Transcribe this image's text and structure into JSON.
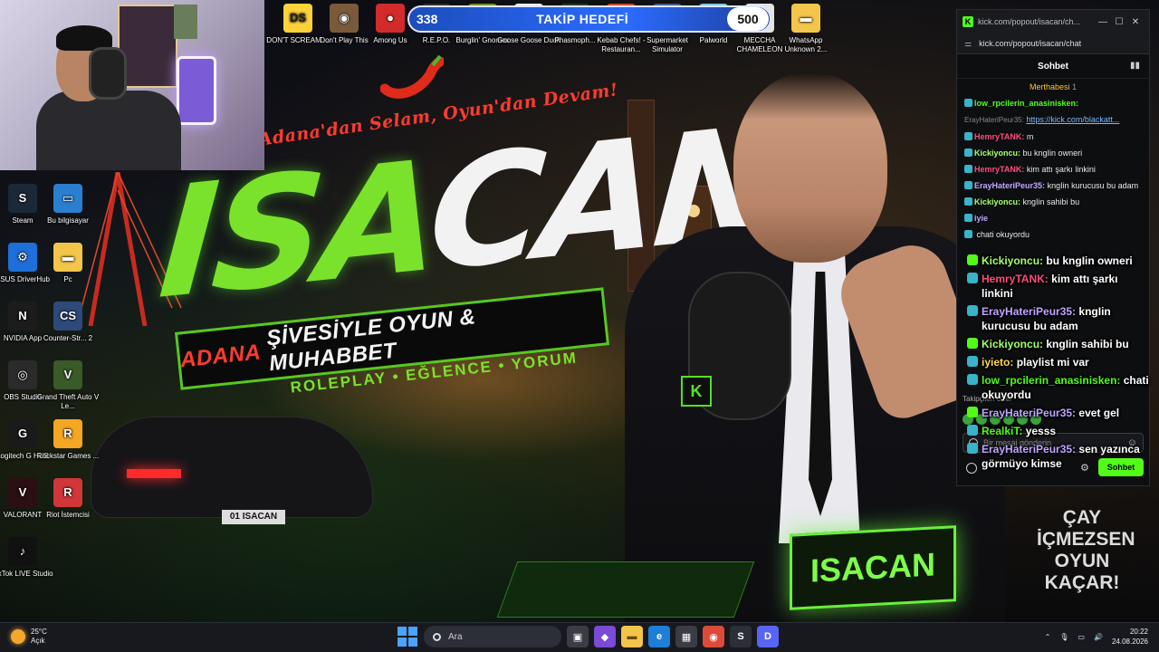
{
  "webcam": {},
  "wallpaper": {
    "tagline": "Adana'dan Selam, Oyun'dan Devam!",
    "logo_part1": "ISA",
    "logo_part2": "CAN",
    "banner_red": "ADANA",
    "banner_white": "ŞİVESİYLE OYUN & MUHABBET",
    "subline": "ROLEPLAY • EĞLENCE • YORUM",
    "desk_sign": "ISACAN",
    "mug_text": [
      "ÇAY",
      "İÇMEZSEN",
      "OYUN",
      "KAÇAR!"
    ],
    "mic_badge": "K",
    "plate": "01 ISACAN"
  },
  "goal": {
    "current": "338",
    "title": "TAKİP HEDEFİ",
    "target": "500",
    "progress": 0.676
  },
  "top_icons": [
    {
      "label": "DON'T SCREAM ...",
      "color": "#ffd23a",
      "glyph": "DS",
      "icon": "dont-scream-icon"
    },
    {
      "label": "Don't Play This",
      "color": "#7a5a3a",
      "glyph": "◉",
      "icon": "dont-play-this-icon"
    },
    {
      "label": "Among Us",
      "color": "#d32b2b",
      "glyph": "●",
      "icon": "among-us-icon"
    },
    {
      "label": "R.E.P.O.",
      "color": "#2d2d2d",
      "glyph": "R",
      "icon": "repo-icon"
    },
    {
      "label": "Burglin' Gnomes",
      "color": "#6b8f2a",
      "glyph": "G",
      "icon": "burglin-gnomes-icon"
    },
    {
      "label": "Goose Goose Duck",
      "color": "#f2f2f2",
      "glyph": "G",
      "icon": "goose-goose-duck-icon"
    },
    {
      "label": "Phasmoph...",
      "color": "#1f3a2e",
      "glyph": "P",
      "icon": "phasmophobia-icon"
    },
    {
      "label": "Kebab Chefs! - Restauran...",
      "color": "#c9462a",
      "glyph": "K",
      "icon": "kebab-chefs-icon"
    },
    {
      "label": "Supermarket Simulator",
      "color": "#3b5e8c",
      "glyph": "S",
      "icon": "supermarket-simulator-icon"
    },
    {
      "label": "Palworld",
      "color": "#7cc6e6",
      "glyph": "P",
      "icon": "palworld-icon"
    },
    {
      "label": "MECCHA CHAMELEON",
      "color": "#e4e4e4",
      "glyph": "M",
      "icon": "meccha-chameleon-icon"
    },
    {
      "label": "WhatsApp Unknown 2...",
      "color": "#f3c54a",
      "glyph": "▬",
      "icon": "folder-icon"
    }
  ],
  "left_icons": [
    {
      "label": "Steam",
      "color": "#1b2838",
      "glyph": "S",
      "icon": "steam-icon"
    },
    {
      "label": "Bu bilgisayar",
      "color": "#2a7fd1",
      "glyph": "▭",
      "icon": "this-pc-icon"
    },
    {
      "label": "ASUS DriverHub",
      "color": "#1e6fd9",
      "glyph": "⚙",
      "icon": "asus-driverhub-icon"
    },
    {
      "label": "Pc",
      "color": "#f3c54a",
      "glyph": "▬",
      "icon": "folder-icon"
    },
    {
      "label": "NVIDIA App",
      "color": "#1c1c1c",
      "glyph": "N",
      "icon": "nvidia-icon"
    },
    {
      "label": "Counter-Str... 2",
      "color": "#2d4a7a",
      "glyph": "CS",
      "icon": "counter-strike-icon"
    },
    {
      "label": "OBS Studio",
      "color": "#2b2b2b",
      "glyph": "◎",
      "icon": "obs-icon"
    },
    {
      "label": "Grand Theft Auto V Le...",
      "color": "#3a5a2a",
      "glyph": "V",
      "icon": "gta-icon"
    },
    {
      "label": "Logitech G HUB",
      "color": "#1a1a1a",
      "glyph": "G",
      "icon": "logitech-ghub-icon"
    },
    {
      "label": "Rockstar Games ...",
      "color": "#f5a623",
      "glyph": "R",
      "icon": "rockstar-icon"
    },
    {
      "label": "VALORANT",
      "color": "#2b0f12",
      "glyph": "V",
      "icon": "valorant-icon"
    },
    {
      "label": "Riot İstemcisi",
      "color": "#d13639",
      "glyph": "R",
      "icon": "riot-client-icon"
    },
    {
      "label": "TikTok LIVE Studio",
      "color": "#111111",
      "glyph": "♪",
      "icon": "tiktok-icon"
    }
  ],
  "chat_window": {
    "title": "kick.com/popout/isacan/ch...",
    "url": "kick.com/popout/isacan/chat",
    "header": "Sohbet",
    "pinned_label": "Merthabesi",
    "pinned_count": "1",
    "messages": [
      {
        "user": "low_rpcilerin_anasinisken:",
        "text": "",
        "cls": "u1"
      },
      {
        "reply": "ErayHateriPeur35:",
        "link": "https://kick.com/blackatt..."
      },
      {
        "user": "HemryTANK:",
        "text": "m",
        "cls": "u2"
      },
      {
        "user": "Kickiyoncu:",
        "text": "bu kngIin owneri",
        "cls": "u4"
      },
      {
        "user": "HemryTANK:",
        "text": "kim attı şarkı linkini",
        "cls": "u2"
      },
      {
        "user": "ErayHateriPeur35:",
        "text": "kngIin kurucusu bu adam",
        "cls": "u3"
      },
      {
        "user": "Kickiyoncu:",
        "text": "kngIin sahibi bu",
        "cls": "u4"
      },
      {
        "user": "iyie",
        "text": "",
        "cls": "u3"
      },
      {
        "user": "",
        "text": "chati okuyordu",
        "cls": "u1"
      }
    ],
    "followers_label": "Takipçileri Özel",
    "input_placeholder": "Bir mesaj gönderin",
    "send_label": "Sohbet"
  },
  "overlay_chat": [
    {
      "user": "Kickiyoncu:",
      "text": "bu kngIin owneri",
      "cls": "n4"
    },
    {
      "user": "HemryTANK:",
      "text": "kim attı şarkı linkini",
      "cls": "n2"
    },
    {
      "user": "ErayHateriPeur35:",
      "text": "kngIin kurucusu bu adam",
      "cls": "n3"
    },
    {
      "user": "Kickiyoncu:",
      "text": "kngIin sahibi bu",
      "cls": "n4"
    },
    {
      "user": "iyieto:",
      "text": "playlist mi var",
      "cls": "n5"
    },
    {
      "user": "low_rpcilerin_anasinisken:",
      "text": "chati okuyordu",
      "cls": "n1"
    },
    {
      "user": "ErayHateriPeur35:",
      "text": "evet gel",
      "cls": "n3"
    },
    {
      "user": "RealkiT:",
      "text": "yesss",
      "cls": "n1"
    },
    {
      "user": "ErayHateriPeur35:",
      "text": "sen yazınca görmüyo kimse",
      "cls": "n3"
    }
  ],
  "taskbar": {
    "temp": "25°C",
    "weather": "Açık",
    "search": "Ara",
    "time": "20:22",
    "date": "24.08.2026"
  }
}
